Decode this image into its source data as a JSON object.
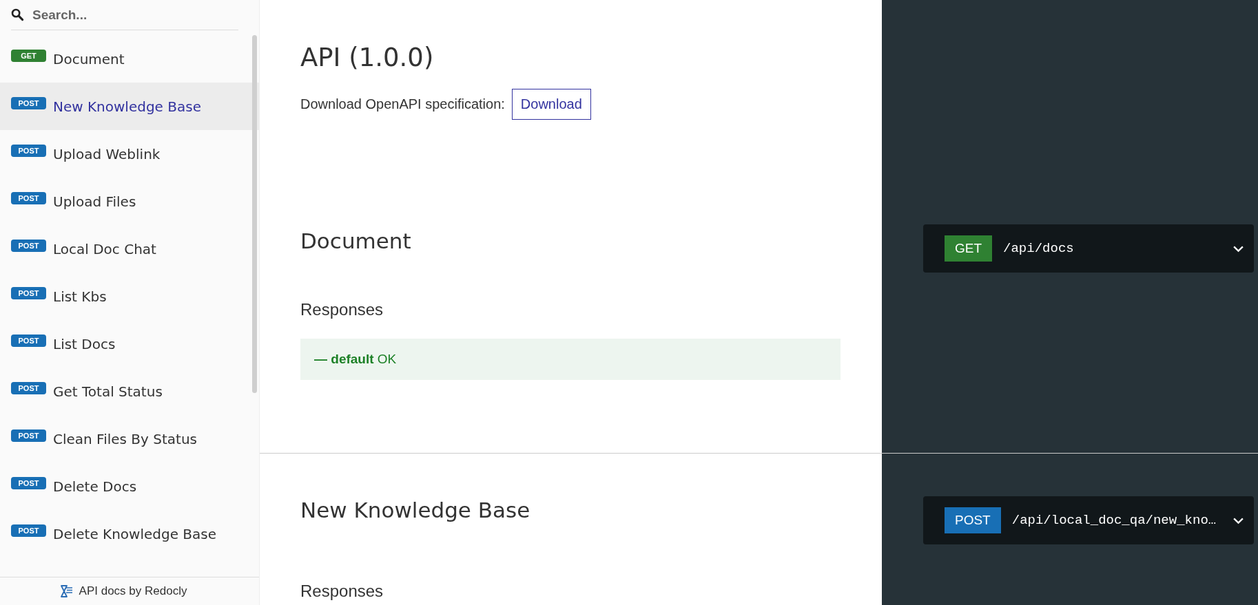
{
  "search": {
    "placeholder": "Search..."
  },
  "sidebar": {
    "items": [
      {
        "method": "GET",
        "label": "Document",
        "selected": false
      },
      {
        "method": "POST",
        "label": "New Knowledge Base",
        "selected": true
      },
      {
        "method": "POST",
        "label": "Upload Weblink",
        "selected": false
      },
      {
        "method": "POST",
        "label": "Upload Files",
        "selected": false
      },
      {
        "method": "POST",
        "label": "Local Doc Chat",
        "selected": false
      },
      {
        "method": "POST",
        "label": "List Kbs",
        "selected": false
      },
      {
        "method": "POST",
        "label": "List Docs",
        "selected": false
      },
      {
        "method": "POST",
        "label": "Get Total Status",
        "selected": false
      },
      {
        "method": "POST",
        "label": "Clean Files By Status",
        "selected": false
      },
      {
        "method": "POST",
        "label": "Delete Docs",
        "selected": false
      },
      {
        "method": "POST",
        "label": "Delete Knowledge Base",
        "selected": false
      }
    ],
    "footer": "API docs by Redocly"
  },
  "intro": {
    "title": "API (1.0.0)",
    "download_label": "Download OpenAPI specification:",
    "download_button": "Download"
  },
  "operations": [
    {
      "title": "Document",
      "responses_heading": "Responses",
      "responses": [
        {
          "text": "**— default** OK"
        }
      ],
      "method": "GET",
      "path": "/api/docs"
    },
    {
      "title": "New Knowledge Base",
      "responses_heading": "Responses",
      "method": "POST",
      "path": "/api/local_doc_qa/new_kno…"
    }
  ]
}
